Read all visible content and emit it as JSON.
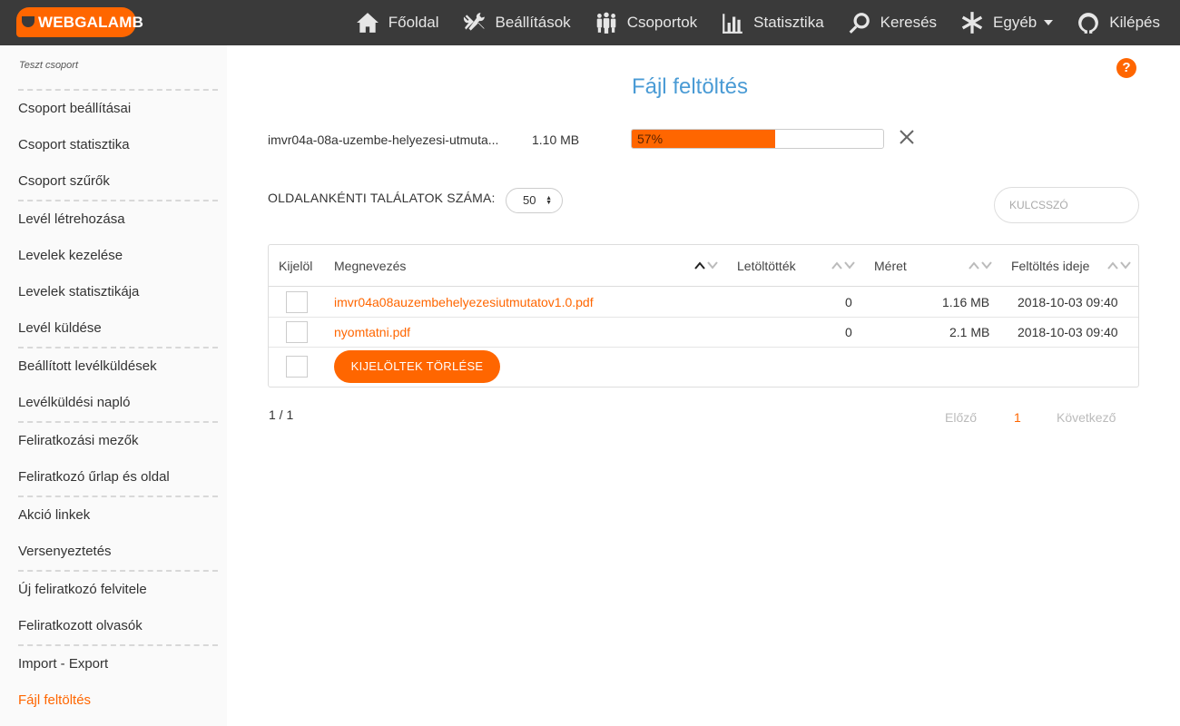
{
  "app": {
    "logo_text": "WEBGALAMB",
    "brand_color": "#ff6600",
    "link_color": "#4a9bd5"
  },
  "nav": {
    "items": [
      {
        "label": "Főoldal",
        "icon": "home-icon"
      },
      {
        "label": "Beállítások",
        "icon": "tools-icon"
      },
      {
        "label": "Csoportok",
        "icon": "group-icon"
      },
      {
        "label": "Statisztika",
        "icon": "bar-chart-icon"
      },
      {
        "label": "Keresés",
        "icon": "search-icon"
      },
      {
        "label": "Egyéb",
        "icon": "asterisk-icon"
      },
      {
        "label": "Kilépés",
        "icon": "logout-icon"
      }
    ]
  },
  "sidebar": {
    "group_title": "Teszt csoport",
    "items": [
      {
        "label": "Csoport beállításai"
      },
      {
        "label": "Csoport statisztika"
      },
      {
        "label": "Csoport szűrők"
      },
      {
        "label": "Levél létrehozása"
      },
      {
        "label": "Levelek kezelése"
      },
      {
        "label": "Levelek statisztikája"
      },
      {
        "label": "Levél küldése"
      },
      {
        "label": "Beállított levélküldések"
      },
      {
        "label": "Levélküldési napló"
      },
      {
        "label": "Feliratkozási mezők"
      },
      {
        "label": "Feliratkozó űrlap és oldal"
      },
      {
        "label": "Akció linkek"
      },
      {
        "label": "Versenyeztetés"
      },
      {
        "label": "Új feliratkozó felvitele"
      },
      {
        "label": "Feliratkozott olvasók"
      },
      {
        "label": "Import - Export"
      },
      {
        "label": "Fájl feltöltés"
      }
    ]
  },
  "main": {
    "title": "Fájl feltöltés",
    "help_icon": "question-icon",
    "upload": {
      "file_name": "imvr04a-08a-uzembe-helyezesi-utmuta...",
      "file_size": "1.10 MB",
      "progress_label": "57%",
      "progress_fraction": 0.57
    },
    "per_page_label": "OLDALANKÉNTI TALÁLATOK SZÁMA:",
    "per_page_value": "50",
    "keyword_placeholder": "KULCSSZÓ",
    "table": {
      "headers": {
        "select": "Kijelöl",
        "name": "Megnevezés",
        "downloads": "Letöltötték",
        "size": "Méret",
        "uploaded": "Feltöltés ideje"
      },
      "rows": [
        {
          "name": "imvr04a08auzembehelyezesiutmutatov1.0.pdf",
          "downloads": "0",
          "size": "1.16 MB",
          "uploaded": "2018-10-03 09:40"
        },
        {
          "name": "nyomtatni.pdf",
          "downloads": "0",
          "size": "2.1 MB",
          "uploaded": "2018-10-03 09:40"
        }
      ],
      "delete_button": "KIJELÖLTEK TÖRLÉSE"
    },
    "pagination": {
      "count": "1 / 1",
      "prev": "Előző",
      "current": "1",
      "next": "Következő"
    }
  }
}
